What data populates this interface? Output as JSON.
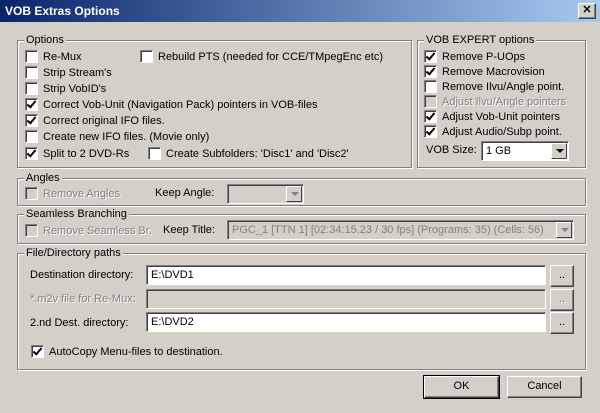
{
  "window": {
    "title": "VOB Extras Options"
  },
  "options": {
    "legend": "Options",
    "remux": "Re-Mux",
    "rebuild_pts": "Rebuild PTS (needed for CCE/TMpegEnc etc)",
    "strip_streams": "Strip Stream's",
    "strip_vobids": "Strip VobID's",
    "correct_vobu": "Correct Vob-Unit (Navigation Pack) pointers in VOB-files",
    "correct_ifo": "Correct original IFO files.",
    "create_ifo": "Create new IFO files. (Movie only)",
    "split_dvdr": "Split to 2 DVD-Rs",
    "create_subfolders": "Create Subfolders: 'Disc1' and 'Disc2'"
  },
  "expert": {
    "legend": "VOB EXPERT options",
    "remove_puops": "Remove P-UOps",
    "remove_macrovision": "Remove Macrovision",
    "remove_ilvu": "Remove Ilvu/Angle point.",
    "adjust_ilvu": "Adjust Ilvu/Angle pointers",
    "adjust_vobu": "Adjust Vob-Unit pointers",
    "adjust_audio": "Adjust Audio/Subp point.",
    "vob_size_label": "VOB Size:",
    "vob_size_value": "1 GB"
  },
  "angles": {
    "legend": "Angles",
    "remove_angles": "Remove Angles",
    "keep_angle_label": "Keep Angle:",
    "keep_angle_value": ""
  },
  "seamless": {
    "legend": "Seamless Branching",
    "remove_seamless": "Remove Seamless Br.",
    "keep_title_label": "Keep Title:",
    "keep_title_value": "PGC_1 [TTN 1] [02:34:15.23 / 30 fps] (Programs: 35) (Cells: 56)"
  },
  "paths": {
    "legend": "File/Directory paths",
    "dest_label": "Destination directory:",
    "dest_value": "E:\\DVD1",
    "m2v_label": "*.m2v file for Re-Mux:",
    "m2v_value": "",
    "dest2_label": "2.nd Dest. directory:",
    "dest2_value": "E:\\DVD2",
    "browse_label": "..",
    "autocopy": "AutoCopy Menu-files to destination."
  },
  "buttons": {
    "ok": "OK",
    "cancel": "Cancel"
  }
}
